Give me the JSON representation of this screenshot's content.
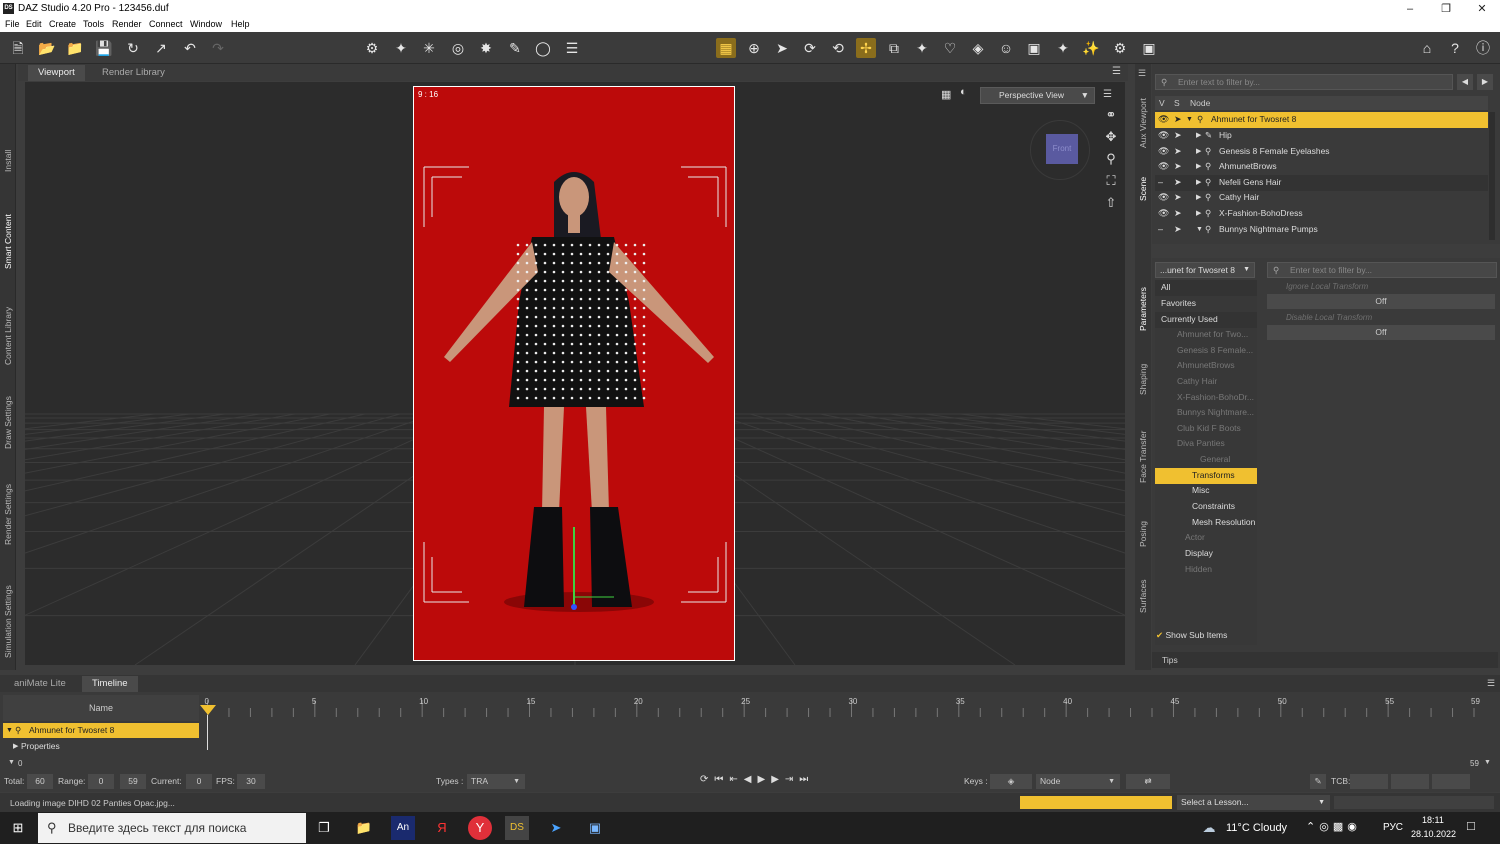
{
  "window": {
    "title": "DAZ Studio 4.20 Pro - 123456.duf",
    "app_badge": "DS"
  },
  "menu": [
    "File",
    "Edit",
    "Create",
    "Tools",
    "Render",
    "Connect",
    "Window",
    "Help"
  ],
  "left_tabs": [
    "Install",
    "Smart Content",
    "Content Library",
    "Draw Settings",
    "Render Settings",
    "Simulation Settings"
  ],
  "viewport_tabs": [
    "Viewport",
    "Render Library"
  ],
  "viewport": {
    "aspect_label": "9 : 16",
    "view_mode": "Perspective View",
    "cube_face": "Front"
  },
  "right_tabs": [
    "Aux Viewport",
    "Scene",
    "Parameters",
    "Shaping",
    "Face Transfer",
    "Posing",
    "Surfaces"
  ],
  "scene": {
    "filter_placeholder": "Enter text to filter by...",
    "col_v": "V",
    "col_s": "S",
    "col_node": "Node",
    "nodes": [
      "Ahmunet for Twosret 8",
      "Hip",
      "Genesis 8 Female Eyelashes",
      "AhmunetBrows",
      "Nefeli Gens Hair",
      "Cathy Hair",
      "X-Fashion-BohoDress",
      "Bunnys Nightmare Pumps"
    ]
  },
  "parameters": {
    "node_select": "...unet for Twosret 8",
    "filter_placeholder": "Enter text to filter by...",
    "categories": [
      "All",
      "Favorites",
      "Currently Used",
      "Ahmunet for Two...",
      "Genesis 8 Female...",
      "AhmunetBrows",
      "Cathy Hair",
      "X-Fashion-BohoDr...",
      "Bunnys Nightmare...",
      "Club Kid F Boots",
      "Diva Panties",
      "General",
      "Transforms",
      "Misc",
      "Constraints",
      "Mesh Resolution",
      "Actor",
      "Display",
      "Hidden"
    ],
    "props": [
      {
        "label": "Ignore Local Transform",
        "value": "Off"
      },
      {
        "label": "Disable Local Transform",
        "value": "Off"
      }
    ],
    "show_sub_items": "Show Sub Items",
    "tips": "Tips"
  },
  "bottom_tabs": [
    "aniMate Lite",
    "Timeline"
  ],
  "timeline": {
    "name_header": "Name",
    "row1": "Ahmunet for Twosret 8",
    "row2": "Properties",
    "ticks": [
      "0",
      "5",
      "10",
      "15",
      "20",
      "25",
      "30",
      "35",
      "40",
      "45",
      "50",
      "55",
      "59"
    ],
    "range_start": "0",
    "range_end": "59",
    "total_label": "Total:",
    "total": "60",
    "range_label": "Range:",
    "range_from": "0",
    "range_to": "59",
    "current_label": "Current:",
    "current": "0",
    "fps_label": "FPS:",
    "fps": "30",
    "types_label": "Types :",
    "types": "TRA",
    "keys_label": "Keys :",
    "keys_mode": "Node",
    "tcb_label": "TCB:"
  },
  "status": {
    "message": "Loading image DIHD 02 Panties Opac.jpg...",
    "lesson": "Select a Lesson..."
  },
  "taskbar": {
    "search_placeholder": "Введите здесь текст для поиска",
    "weather": "11°C  Cloudy",
    "lang": "РУС",
    "time": "18:11",
    "date": "28.10.2022"
  },
  "colors": {
    "accent": "#f0c030",
    "canvas_bg": "#bc0a0a",
    "panel": "#3a3a3a"
  }
}
